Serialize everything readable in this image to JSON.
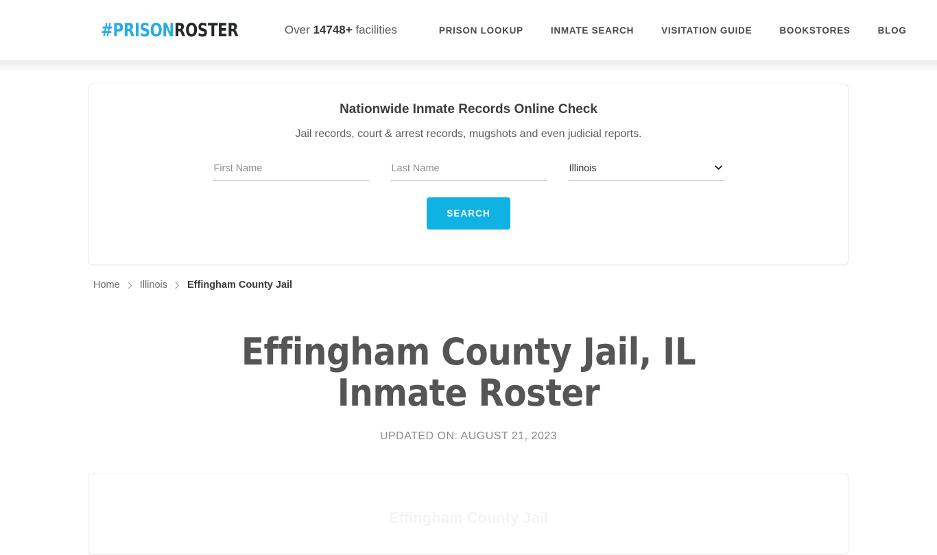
{
  "header": {
    "logo": {
      "part1": "#PRISON",
      "part2": "ROSTER",
      "accent_color": "#29ABE2",
      "dark_color": "#25282A"
    },
    "facility_count_prefix": "Over ",
    "facility_count_number": "14748+",
    "facility_count_suffix": " facilities",
    "nav": [
      {
        "label": "PRISON LOOKUP"
      },
      {
        "label": "INMATE SEARCH"
      },
      {
        "label": "VISITATION GUIDE"
      },
      {
        "label": "BOOKSTORES"
      },
      {
        "label": "BLOG"
      }
    ]
  },
  "search_card": {
    "title": "Nationwide Inmate Records Online Check",
    "subtitle": "Jail records, court & arrest records, mugshots and even judicial reports.",
    "first_name_placeholder": "First Name",
    "first_name_value": "",
    "last_name_placeholder": "Last Name",
    "last_name_value": "",
    "state_selected": "Illinois",
    "state_options": [
      "Illinois"
    ],
    "search_button": "SEARCH",
    "button_color": "#0FB2E3"
  },
  "breadcrumb": {
    "items": [
      {
        "label": "Home"
      },
      {
        "label": "Illinois"
      },
      {
        "label": "Effingham County Jail"
      }
    ],
    "separator": "›"
  },
  "page": {
    "title": "Effingham County Jail, IL Inmate Roster",
    "updated_on": "UPDATED ON: AUGUST 21, 2023"
  },
  "content_card": {
    "partial_text": "Effingham County Jail"
  }
}
